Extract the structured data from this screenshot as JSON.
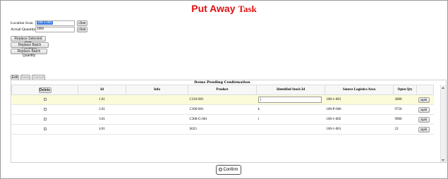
{
  "title": {
    "part1": "Put Away",
    "part2": "Task"
  },
  "form": {
    "location_label": "Location Scan",
    "location_value": "100-1-001",
    "quantity_label": "Actual Quantity",
    "quantity_value": "2800",
    "clear_label": "clear"
  },
  "actions": {
    "replace_selected": "Replace Selected Item",
    "replace_batch_locations": "Replace Batch Locations",
    "replace_batch_quantity": "Replace Batch Quantity"
  },
  "toolbar": {
    "edit": "Edit",
    "save": "Save",
    "cancel": "Cancel"
  },
  "grid": {
    "title": "Items Pending Confirmation",
    "delete_label": "Delete",
    "columns": [
      "Id",
      "Info",
      "Product",
      "Identified Stock Id",
      "Source Logistics Area",
      "Open Qty"
    ],
    "split_label": "Split",
    "rows": [
      {
        "id": "1.01",
        "info": "",
        "product": "C310-001",
        "stock_id": "j",
        "area": "100-1-001",
        "qty": "2800"
      },
      {
        "id": "2.01",
        "info": "",
        "product": "C300-001",
        "stock_id": "k",
        "area": "100-P-006",
        "qty": "9750"
      },
      {
        "id": "3.01",
        "info": "",
        "product": "C300-G-001",
        "stock_id": "l",
        "area": "100-1-002",
        "qty": "9900"
      },
      {
        "id": "4.01",
        "info": "",
        "product": "S023",
        "stock_id": "",
        "area": "100-1-001",
        "qty": "23"
      }
    ]
  },
  "confirm_label": "Confirm",
  "colors": {
    "title": "#e01010",
    "selection": "#3a7de0",
    "selected_row": "#fbfbd9"
  }
}
